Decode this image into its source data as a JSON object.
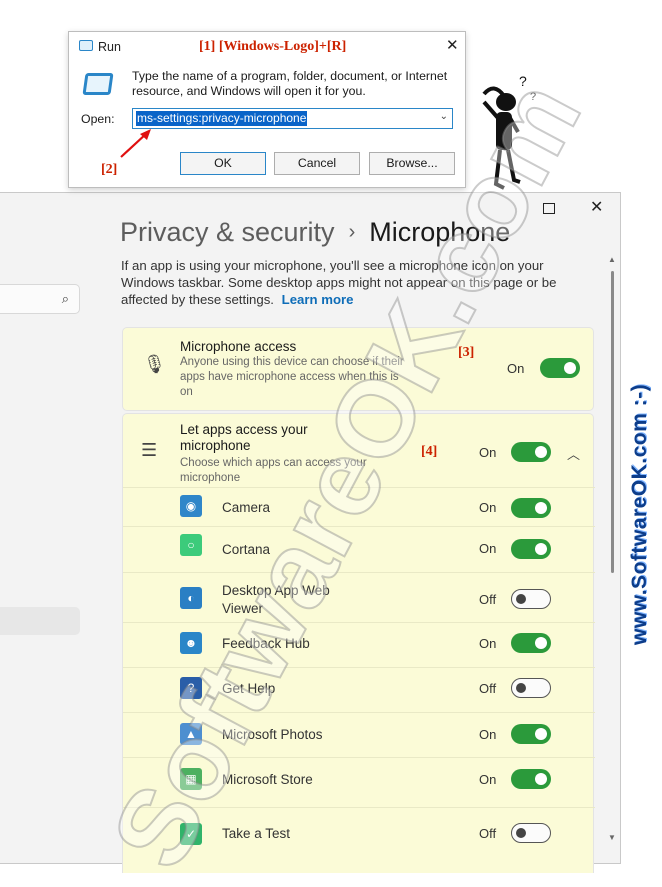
{
  "run_dialog": {
    "title": "Run",
    "marker": "[1] [Windows-Logo]+[R]",
    "description": "Type the name of a program, folder, document, or Internet resource, and Windows will open it for you.",
    "open_label": "Open:",
    "command": "ms-settings:privacy-microphone",
    "buttons": {
      "ok": "OK",
      "cancel": "Cancel",
      "browse": "Browse..."
    },
    "marker2": "[2]"
  },
  "settings": {
    "breadcrumb_parent": "Privacy & security",
    "breadcrumb_sep": "›",
    "page_title": "Microphone",
    "description": "If an app is using your microphone, you'll see a microphone icon on your Windows taskbar. Some desktop apps might not appear on this page or be affected by these settings.",
    "learn_more": "Learn more",
    "microphone_access": {
      "title": "Microphone access",
      "subtitle": "Anyone using this device can choose if their apps have microphone access when this is on",
      "state": "On",
      "marker": "[3]"
    },
    "let_apps": {
      "title": "Let apps access your microphone",
      "subtitle": "Choose which apps can access your microphone",
      "state": "On",
      "marker": "[4]"
    },
    "apps": [
      {
        "name": "Camera",
        "state": "On",
        "icon": "camera-icon",
        "color": "#2f86c9"
      },
      {
        "name": "Cortana",
        "state": "On",
        "icon": "cortana-icon",
        "color": "#3ccb7b"
      },
      {
        "name": "Desktop App Web Viewer",
        "state": "Off",
        "icon": "webview-icon",
        "color": "#2a7fc4"
      },
      {
        "name": "Feedback Hub",
        "state": "On",
        "icon": "feedback-hub-icon",
        "color": "#2a86c8"
      },
      {
        "name": "Get Help",
        "state": "Off",
        "icon": "get-help-icon",
        "color": "#2a5ea8"
      },
      {
        "name": "Microsoft Photos",
        "state": "On",
        "icon": "photos-icon",
        "color": "#4d8fd0"
      },
      {
        "name": "Microsoft Store",
        "state": "On",
        "icon": "store-icon",
        "color": "#4cb060"
      },
      {
        "name": "Take a Test",
        "state": "Off",
        "icon": "take-a-test-icon",
        "color": "#30b36a"
      }
    ]
  },
  "watermark_vertical": "www.SoftwareOK.com :-)",
  "watermark_big": "SoftwareOK.com"
}
